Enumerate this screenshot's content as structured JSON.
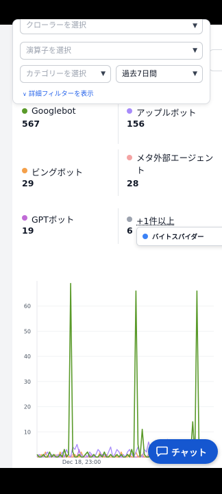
{
  "filters": {
    "crawler_placeholder": "クローラーを選択",
    "operator_placeholder": "演算子を選択",
    "category_placeholder": "カテゴリーを選択",
    "period_value": "過去7日間",
    "advanced_link": "詳細フィルターを表示"
  },
  "stats": [
    {
      "label": "Googlebot",
      "value": "567",
      "color": "#5a9a2a"
    },
    {
      "label": "アップルボット",
      "value": "156",
      "color": "#a78bfa"
    },
    {
      "label": "ビングボット",
      "value": "29",
      "color": "#f4a04a"
    },
    {
      "label": "メタ外部エージェント",
      "value": "28",
      "color": "#f4a3a3"
    },
    {
      "label": "GPTボット",
      "value": "19",
      "color": "#c06bd6"
    },
    {
      "label": "+1件以上",
      "value": "6",
      "color": "#9ca3af"
    }
  ],
  "tooltip": {
    "label": "バイトスパイダー",
    "color": "#3b82f6"
  },
  "chart_data": {
    "type": "line",
    "yticks": [
      10,
      20,
      30,
      40,
      50,
      60
    ],
    "ylim": [
      0,
      70
    ],
    "xtick_label": "Dec 18, 23:00",
    "series": [
      {
        "name": "Googlebot",
        "color": "#5a9a2a",
        "values": [
          1,
          0,
          0,
          1,
          0,
          0,
          2,
          0,
          1,
          0,
          0,
          1,
          0,
          3,
          0,
          1,
          69,
          2,
          0,
          0,
          1,
          0,
          0,
          1,
          2,
          0,
          0,
          1,
          0,
          0,
          1,
          0,
          2,
          0,
          0,
          1,
          0,
          0,
          1,
          0,
          1,
          0,
          0,
          1,
          0,
          3,
          0,
          66,
          5,
          0,
          11,
          1,
          0,
          0,
          1,
          0,
          2,
          0,
          1,
          0,
          0,
          1,
          0,
          2,
          0,
          1,
          0,
          0,
          3,
          0,
          1,
          0,
          0,
          1,
          14,
          0,
          66,
          2,
          0,
          1,
          0,
          0,
          1,
          0,
          1
        ]
      },
      {
        "name": "アップルボット",
        "color": "#a78bfa",
        "values": [
          0,
          1,
          0,
          0,
          1,
          2,
          0,
          1,
          0,
          0,
          1,
          0,
          2,
          0,
          3,
          1,
          0,
          4,
          3,
          5,
          2,
          1,
          0,
          1,
          0,
          2,
          1,
          0,
          1,
          3,
          2,
          0,
          1,
          0,
          2,
          4,
          0,
          1,
          3,
          2,
          0,
          1,
          0,
          2,
          3,
          1,
          0,
          2,
          4,
          1,
          0,
          3,
          2,
          6,
          3,
          1,
          0,
          2,
          4,
          5,
          1,
          3,
          7,
          2,
          5,
          3,
          1,
          0,
          2,
          1,
          0,
          3,
          4,
          2,
          0,
          1,
          3,
          2,
          0,
          1,
          2,
          0,
          1,
          3,
          2
        ]
      },
      {
        "name": "ビングボット",
        "color": "#f4a04a",
        "values": [
          0,
          0,
          1,
          0,
          2,
          0,
          0,
          1,
          0,
          0,
          0,
          2,
          0,
          0,
          1,
          0,
          0,
          0,
          1,
          0,
          0,
          2,
          0,
          1,
          0,
          0,
          0,
          1,
          0,
          0,
          2,
          0,
          0,
          1,
          0,
          0,
          0,
          1,
          0,
          0,
          2,
          0,
          0,
          0,
          1,
          0,
          0,
          2,
          0,
          0,
          1,
          0,
          0,
          0,
          2,
          0,
          0,
          1,
          0,
          0,
          0,
          2,
          0,
          0,
          1,
          0,
          0,
          0,
          1,
          0,
          0,
          2,
          0,
          0,
          1,
          0,
          0,
          0,
          1,
          0,
          0,
          0,
          2,
          0,
          0
        ]
      },
      {
        "name": "GPTボット",
        "color": "#c06bd6",
        "values": [
          0,
          0,
          0,
          1,
          0,
          0,
          0,
          0,
          1,
          0,
          0,
          0,
          0,
          0,
          1,
          0,
          0,
          0,
          0,
          0,
          3,
          0,
          0,
          0,
          0,
          1,
          0,
          0,
          0,
          0,
          0,
          1,
          0,
          0,
          0,
          0,
          0,
          1,
          0,
          0,
          0,
          0,
          0,
          1,
          0,
          0,
          0,
          0,
          0,
          1,
          0,
          0,
          0,
          0,
          0,
          1,
          0,
          0,
          0,
          0,
          0,
          1,
          0,
          0,
          0,
          0,
          0,
          1,
          0,
          0,
          0,
          0,
          0,
          1,
          0,
          0,
          0,
          0,
          0,
          1,
          0,
          0,
          0,
          0,
          0
        ]
      },
      {
        "name": "メタ外部エージェント",
        "color": "#f4a3a3",
        "values": [
          0,
          1,
          0,
          0,
          0,
          0,
          0,
          0,
          0,
          1,
          0,
          0,
          0,
          0,
          0,
          0,
          0,
          1,
          0,
          0,
          0,
          0,
          0,
          0,
          0,
          0,
          1,
          0,
          0,
          0,
          0,
          0,
          0,
          0,
          0,
          1,
          0,
          0,
          0,
          0,
          0,
          0,
          0,
          0,
          1,
          0,
          0,
          0,
          0,
          0,
          0,
          0,
          0,
          1,
          0,
          0,
          0,
          0,
          0,
          0,
          0,
          0,
          1,
          0,
          0,
          0,
          0,
          0,
          0,
          0,
          0,
          1,
          0,
          0,
          0,
          0,
          0,
          0,
          0,
          0,
          1,
          0,
          0,
          0,
          0
        ]
      }
    ]
  },
  "chat_button": {
    "label": "チャット"
  }
}
